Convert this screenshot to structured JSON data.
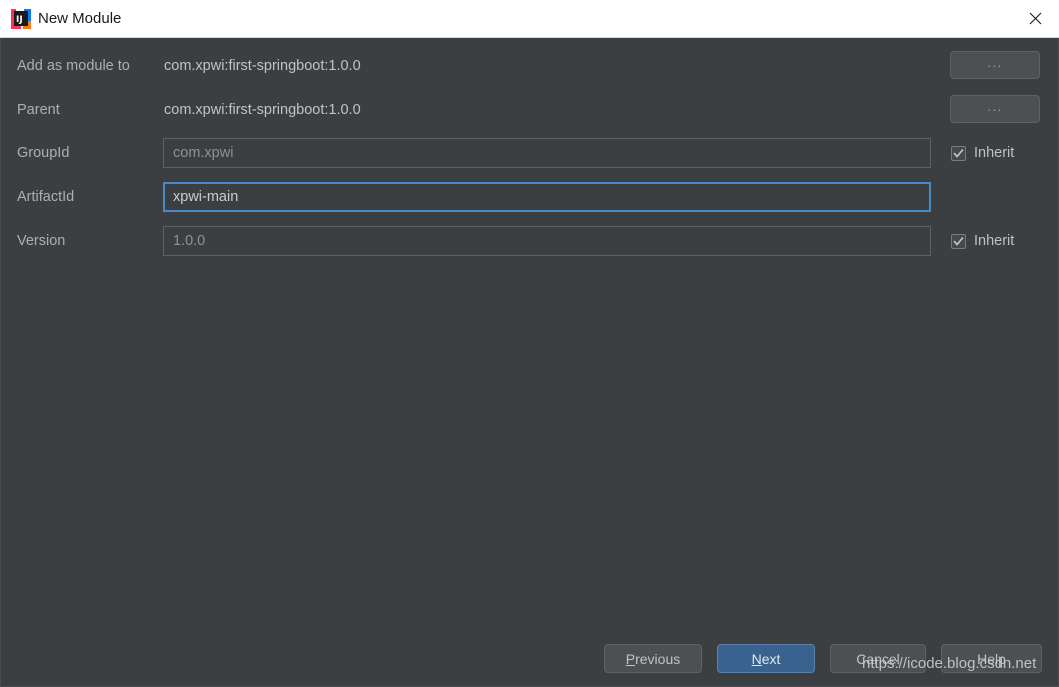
{
  "window": {
    "title": "New Module",
    "icon": "intellij-idea-logo",
    "close_icon": "close-icon"
  },
  "form": {
    "rows": [
      {
        "label": "Add as module to",
        "value": "com.xpwi:first-springboot:1.0.0",
        "kind": "static",
        "browse_label": "..."
      },
      {
        "label": "Parent",
        "value": "com.xpwi:first-springboot:1.0.0",
        "kind": "static",
        "browse_label": "..."
      },
      {
        "label": "GroupId",
        "value": "com.xpwi",
        "kind": "input",
        "focused": false,
        "inherit_label": "Inherit",
        "inherit_checked": true
      },
      {
        "label": "ArtifactId",
        "value": "xpwi-main",
        "kind": "input",
        "focused": true,
        "inherit_label": "",
        "inherit_checked": false
      },
      {
        "label": "Version",
        "value": "1.0.0",
        "kind": "input",
        "focused": false,
        "inherit_label": "Inherit",
        "inherit_checked": true
      }
    ]
  },
  "buttons": {
    "previous": {
      "prefix": "",
      "mnemonic": "P",
      "suffix": "revious"
    },
    "next": {
      "prefix": "",
      "mnemonic": "N",
      "suffix": "ext"
    },
    "cancel": {
      "label": "Cancel"
    },
    "help": {
      "label": "Help"
    }
  },
  "watermark": {
    "text": "https://icode.blog.csdn.net"
  },
  "colors": {
    "dialog_background": "#3c3f41",
    "titlebar_background": "#ffffff",
    "focus_border": "#4a88c7",
    "primary_button": "#3a628f",
    "label_text": "#a9b0b5"
  }
}
